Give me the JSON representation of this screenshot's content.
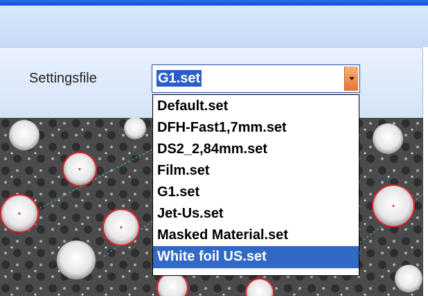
{
  "settings_label": "Settingsfile",
  "combo": {
    "value": "G1.set"
  },
  "dropdown": {
    "options": [
      "Default.set",
      "DFH-Fast1,7mm.set",
      "DS2_2,84mm.set",
      "Film.set",
      "G1.set",
      "Jet-Us.set",
      "Masked Material.set",
      "White foil US.set"
    ],
    "highlighted": "White foil US.set"
  },
  "colors": {
    "titlebar": "#0a4fd6",
    "selection": "#316ac5",
    "combo_button": "#e9733a",
    "detection_circle": "#e0202a",
    "guide_line": "#40c8c8"
  },
  "icons": {
    "combo_button": "chevron-down-icon"
  }
}
